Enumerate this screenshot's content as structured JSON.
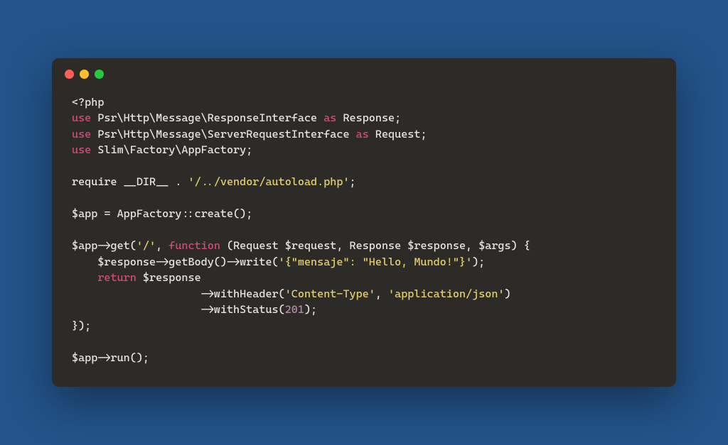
{
  "colors": {
    "bg": "#235389",
    "window": "#2d2b27",
    "dot_red": "#ff5f56",
    "dot_yellow": "#ffbd2e",
    "dot_green": "#27c93f"
  },
  "code": {
    "line1": {
      "tag": "<?php"
    },
    "line2": {
      "use": "use",
      "ns": " Psr\\Http\\Message\\ResponseInterface ",
      "as": "as",
      "alias": " Response;"
    },
    "line3": {
      "use": "use",
      "ns": " Psr\\Http\\Message\\ServerRequestInterface ",
      "as": "as",
      "alias": " Request;"
    },
    "line4": {
      "use": "use",
      "ns": " Slim\\Factory\\AppFactory;"
    },
    "line6": {
      "pre": "require __DIR__ . ",
      "str": "'/../vendor/autoload.php'",
      "post": ";"
    },
    "line8": {
      "txt": "$app = AppFactory::create();"
    },
    "line10": {
      "pre": "$app->get(",
      "str": "'/'",
      "mid": ", ",
      "fn": "function",
      "post": " (Request $request, Response $response, $args) {"
    },
    "line11": {
      "pre": "    $response->getBody()->write(",
      "str": "'{\"mensaje\": \"Hello, Mundo!\"}'",
      "post": ");"
    },
    "line12": {
      "indent": "    ",
      "ret": "return",
      "post": " $response"
    },
    "line13": {
      "pre": "                    ->withHeader(",
      "str1": "'Content-Type'",
      "mid": ", ",
      "str2": "'application/json'",
      "post": ")"
    },
    "line14": {
      "pre": "                    ->withStatus(",
      "num": "201",
      "post": ");"
    },
    "line15": {
      "txt": "});"
    },
    "line17": {
      "txt": "$app->run();"
    }
  }
}
